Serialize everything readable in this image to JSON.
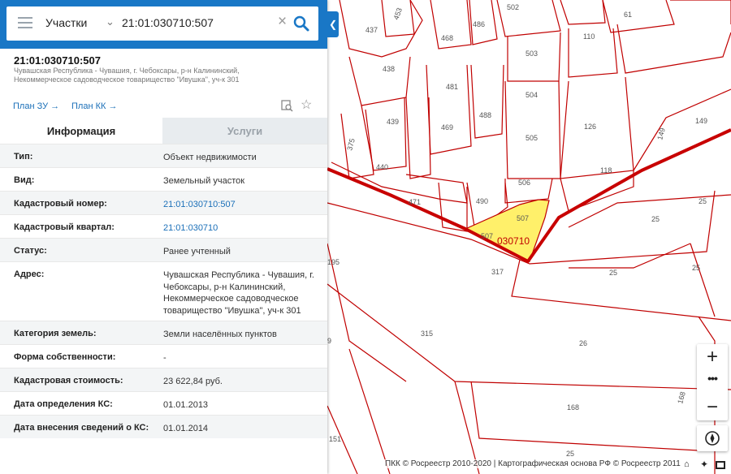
{
  "search": {
    "type_label": "Участки",
    "query": "21:01:030710:507"
  },
  "object": {
    "number": "21:01:030710:507",
    "address": "Чувашская Республика - Чувашия, г. Чебоксары, р-н Калининский, Некоммерческое садоводческое товарищество \"Ивушка\", уч-к 301"
  },
  "links": {
    "plan_zu": "План ЗУ",
    "plan_kk": "План КК"
  },
  "tabs": {
    "info": "Информация",
    "services": "Услуги"
  },
  "rows": [
    {
      "label": "Тип:",
      "value": "Объект недвижимости"
    },
    {
      "label": "Вид:",
      "value": "Земельный участок"
    },
    {
      "label": "Кадастровый номер:",
      "value": "21:01:030710:507"
    },
    {
      "label": "Кадастровый квартал:",
      "value": "21:01:030710"
    },
    {
      "label": "Статус:",
      "value": "Ранее учтенный"
    },
    {
      "label": "Адрес:",
      "value": "Чувашская Республика - Чувашия, г. Чебоксары, р-н Калининский, Некоммерческое садоводческое товарищество \"Ивушка\", уч-к 301"
    },
    {
      "label": "Категория земель:",
      "value": "Земли населённых пунктов"
    },
    {
      "label": "Форма собственности:",
      "value": "-"
    },
    {
      "label": "Кадастровая стоимость:",
      "value": "23 622,84 руб."
    },
    {
      "label": "Дата определения КС:",
      "value": "01.01.2013"
    },
    {
      "label": "Дата внесения сведений о КС:",
      "value": "01.01.2014"
    }
  ],
  "map": {
    "copyright": "ПКК © Росреестр 2010-2020 | Картографическая основа РФ © Росреестр 2011",
    "parcel_labels": [
      "437",
      "453",
      "468",
      "486",
      "502",
      "61",
      "110",
      "438",
      "503",
      "481",
      "504",
      "439",
      "469",
      "488",
      "126",
      "375",
      "505",
      "149",
      "149",
      "440",
      "506",
      "118",
      "471",
      "490",
      "507",
      "25",
      "25",
      "507",
      "030710",
      "195",
      "317",
      "25",
      "25",
      "315",
      "26",
      "9",
      "168",
      "168",
      "151",
      "25"
    ],
    "colors": {
      "boundary": "#c00000",
      "highlight_fill": "#fff06a",
      "quarter_line": "#c80000"
    }
  }
}
